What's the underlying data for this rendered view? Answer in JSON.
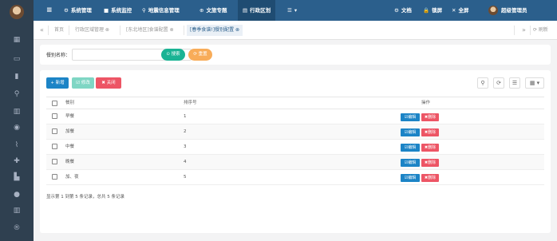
{
  "topnav": {
    "items": [
      {
        "icon": "⚙",
        "label": "系统管理"
      },
      {
        "icon": "■",
        "label": "系统监控"
      },
      {
        "icon": "⚲",
        "label": "地震信息管理"
      },
      {
        "icon": "⊕",
        "label": "文旅专题"
      },
      {
        "icon": "▤",
        "label": "行政区划"
      },
      {
        "icon": "☰",
        "label": "▾"
      }
    ],
    "right": [
      {
        "icon": "⚙",
        "label": "文档"
      },
      {
        "icon": "🔒",
        "label": "锁屏"
      },
      {
        "icon": "✕",
        "label": "全屏"
      },
      {
        "icon": "",
        "label": "超级管理员"
      }
    ]
  },
  "tabs": {
    "back": "«",
    "items": [
      "首页",
      "行政区域管理 ⊗",
      "[东北地区]食谱配置 ⊗",
      "[春季食谱!]餐别配置 ⊗"
    ],
    "forward": "»",
    "refresh": "⟳ 刷新"
  },
  "search": {
    "label": "餐别名称：",
    "placeholder": "",
    "search_button": "⊙ 搜索",
    "reset_button": "⟳ 重置"
  },
  "toolbar": {
    "add": "+ 新增",
    "edit": "☑ 修改",
    "delete": "✖ 关闭",
    "tools": [
      "⚲",
      "⟳",
      "☰",
      "▦ ▾"
    ]
  },
  "table": {
    "headers": [
      "餐别",
      "排序号",
      "操作"
    ],
    "rows": [
      {
        "name": "早餐",
        "order": "1"
      },
      {
        "name": "加餐",
        "order": "2"
      },
      {
        "name": "中餐",
        "order": "3"
      },
      {
        "name": "晚餐",
        "order": "4"
      },
      {
        "name": "加、夜",
        "order": "5"
      }
    ],
    "edit_label": "☑编辑",
    "delete_label": "✖删除"
  },
  "footer": "显示第 1 到第 5 条记录，总共 5 条记录",
  "colors": {
    "sidebar": "#2f4050",
    "topbar": "#2b5f8c",
    "primary": "#1c84c6",
    "success": "#1ab394",
    "warning": "#f8ac59",
    "danger": "#ed5565"
  }
}
